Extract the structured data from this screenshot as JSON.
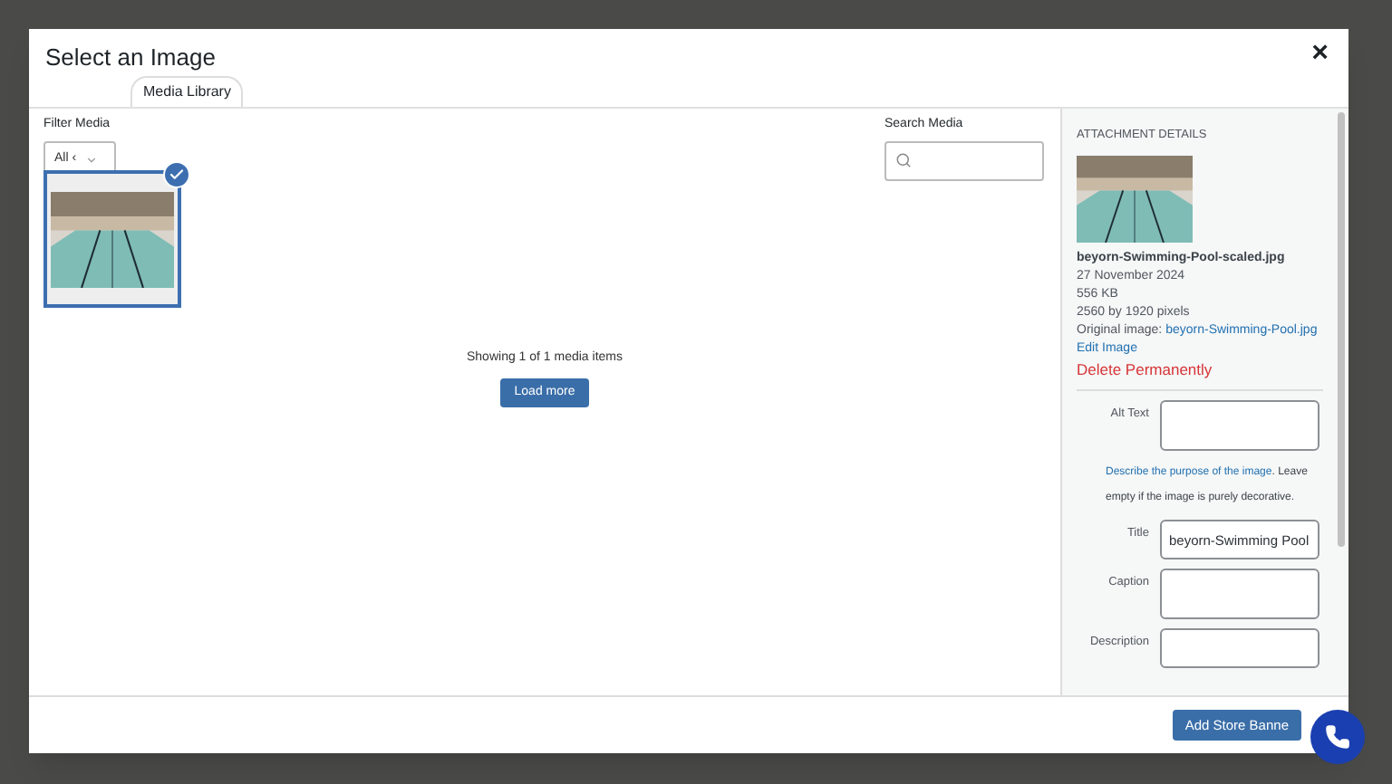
{
  "dialog": {
    "title": "Select an Image",
    "close": "×"
  },
  "tabs": [
    {
      "label": "Media Library",
      "selected": true
    }
  ],
  "filter": {
    "label": "Filter Media",
    "value": "All ‹"
  },
  "search": {
    "label": "Search Media"
  },
  "media_items": [
    {
      "selected": true
    }
  ],
  "status": "Showing 1 of 1 media items",
  "load_more": "Load more",
  "details": {
    "heading": "ATTACHMENT DETAILS",
    "filename": "beyorn-Swimming-Pool-scaled.jpg",
    "date": "27 November 2024",
    "size": "556 KB",
    "dimensions": "2560 by 1920 pixels",
    "original_label": "Original image:",
    "original_link": "beyorn-Swimming-Pool.jpg",
    "edit": "Edit Image",
    "delete": "Delete Permanently"
  },
  "fields": [
    {
      "kind": "textarea",
      "label": "Alt Text"
    },
    {
      "kind": "help",
      "link": "Describe the purpose of the image",
      "text": ". Leave empty if the image is purely decorative."
    },
    {
      "kind": "input",
      "label": "Title",
      "value": "beyorn-Swimming Pool"
    },
    {
      "kind": "textarea",
      "label": "Caption"
    },
    {
      "kind": "input",
      "label": "Description"
    }
  ],
  "footer": {
    "button": "Add Store Banne"
  }
}
